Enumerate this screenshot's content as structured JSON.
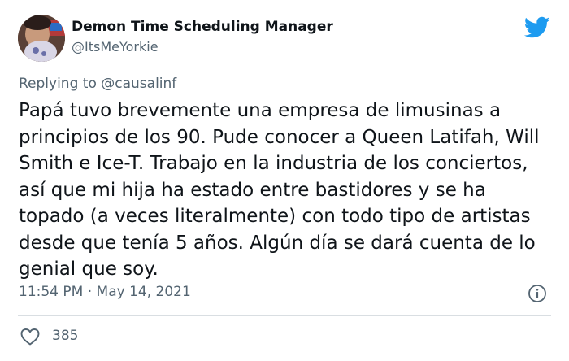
{
  "author": {
    "display_name": "Demon Time Scheduling Manager",
    "handle": "@ItsMeYorkie"
  },
  "reply": {
    "prefix": "Replying to ",
    "mention": "@causalinf"
  },
  "tweet": {
    "text": "Papá tuvo brevemente una empresa de limusinas a principios de los 90. Pude conocer a Queen Latifah, Will Smith e Ice-T. Trabajo en la industria de los conciertos, así que mi hija ha estado entre bastidores y se ha topado (a veces literalmente) con todo tipo de artistas desde que tenía 5 años. Algún día se dará cuenta de lo genial que soy."
  },
  "meta": {
    "time": "11:54 PM",
    "separator": " · ",
    "date": "May 14, 2021"
  },
  "actions": {
    "like_count": "385"
  },
  "icons": {
    "brand": "twitter-bird-icon",
    "info": "info-icon",
    "like": "heart-icon"
  },
  "colors": {
    "brand": "#1d9bf0",
    "secondary_text": "#536471",
    "primary_text": "#0f1419",
    "divider": "#d9dee2"
  }
}
